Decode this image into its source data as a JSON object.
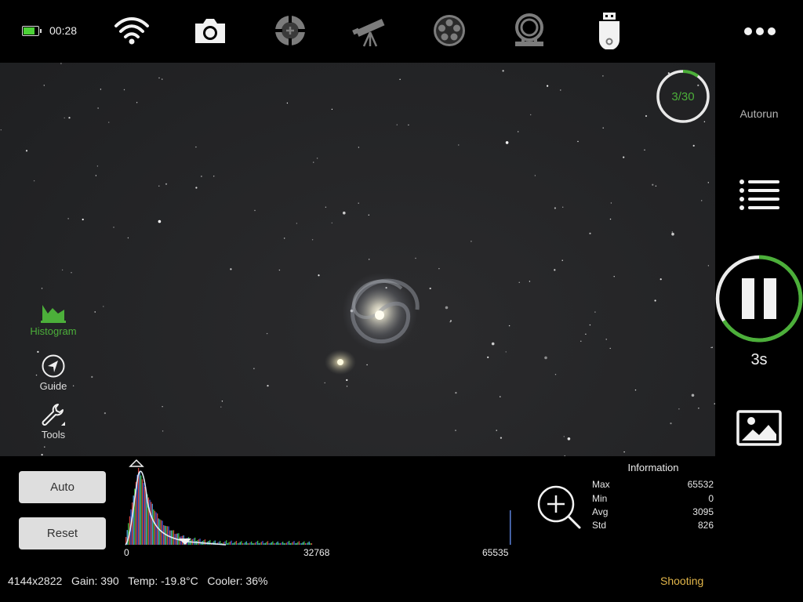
{
  "status_bar_top": {
    "clock": "00:28",
    "battery_level": 0.85
  },
  "toolbar": {
    "icons": [
      "wifi-icon",
      "camera-icon",
      "focuser-icon",
      "telescope-icon",
      "filter-wheel-icon",
      "rotator-icon",
      "usb-drive-icon"
    ]
  },
  "sequence": {
    "progress_text": "3/30",
    "progress": 0.1,
    "autorun_label": "Autorun",
    "exposure_time": "3s",
    "exposure_progress": 0.66
  },
  "left_tools": {
    "histogram_label": "Histogram",
    "guide_label": "Guide",
    "tools_label": "Tools"
  },
  "histogram_panel": {
    "auto_label": "Auto",
    "reset_label": "Reset",
    "axis_labels": [
      "0",
      "32768",
      "65535"
    ],
    "info_title": "Information",
    "stats": [
      {
        "label": "Max",
        "value": "65532"
      },
      {
        "label": "Min",
        "value": "0"
      },
      {
        "label": "Avg",
        "value": "3095"
      },
      {
        "label": "Std",
        "value": "826"
      }
    ]
  },
  "status_bar_bottom": {
    "text": "4144x2822   Gain: 390   Temp: -19.8°C   Cooler: 36%",
    "state": "Shooting"
  },
  "colors": {
    "accent_green": "#4caf3a",
    "shooting_amber": "#e2b64a",
    "sky": "#252628"
  }
}
